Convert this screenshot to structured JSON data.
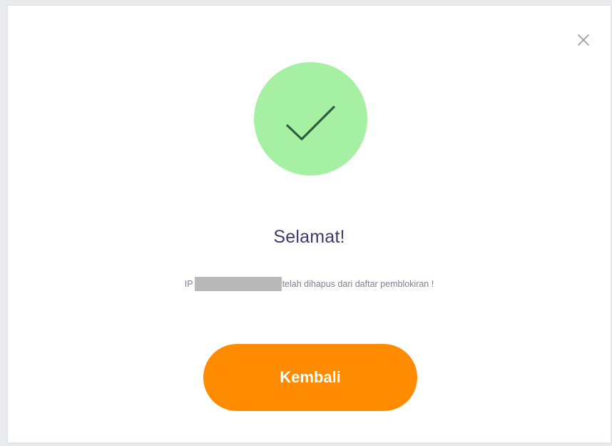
{
  "dialog": {
    "close_icon": "close-icon",
    "success_icon": "check-icon",
    "title": "Selamat!",
    "message_prefix": "IP",
    "ip_address": "",
    "message_suffix": "telah dihapus dari daftar pemblokiran !",
    "button_label": "Kembali"
  },
  "colors": {
    "success_circle": "#a6f0a3",
    "check_mark": "#2f5f3a",
    "title": "#3d3b6e",
    "message": "#7d7f96",
    "button": "#ff8c00",
    "button_text": "#ffffff",
    "redaction": "#b9b9b9"
  }
}
